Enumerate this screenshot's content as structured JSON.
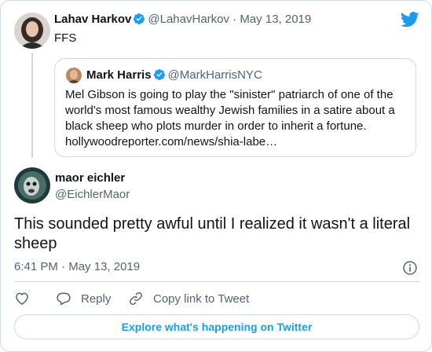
{
  "parent_tweet": {
    "name": "Lahav Harkov",
    "handle": "@LahavHarkov",
    "separator": "·",
    "date": "May 13, 2019",
    "text": "FFS",
    "avatar_icon": "user-avatar-photo",
    "verified_icon": "verified-badge-icon"
  },
  "quoted_tweet": {
    "name": "Mark Harris",
    "handle": "@MarkHarrisNYC",
    "text_lines": [
      "Mel Gibson is going to play the \"sinister\" patriarch of one of the",
      "world's most famous wealthy Jewish families in a satire about a",
      "black sheep who plots murder in order to inherit a fortune.",
      "hollywoodreporter.com/news/shia-labe…"
    ]
  },
  "main_tweet": {
    "name": "maor eichler",
    "handle": "@EichlerMaor",
    "text_lines": [
      "This sounded pretty awful until I realized it wasn't a literal",
      "sheep"
    ],
    "time": "6:41 PM",
    "separator": "·",
    "date": "May 13, 2019"
  },
  "actions": {
    "like_icon": "heart-icon",
    "reply_label": "Reply",
    "reply_icon": "reply-bubble-icon",
    "copy_label": "Copy link to Tweet",
    "copy_icon": "link-icon"
  },
  "explore_label": "Explore what's happening on Twitter",
  "colors": {
    "accent": "#1d9bf0",
    "text": "#0f1419",
    "muted": "#536471",
    "border": "#cfd9de"
  }
}
